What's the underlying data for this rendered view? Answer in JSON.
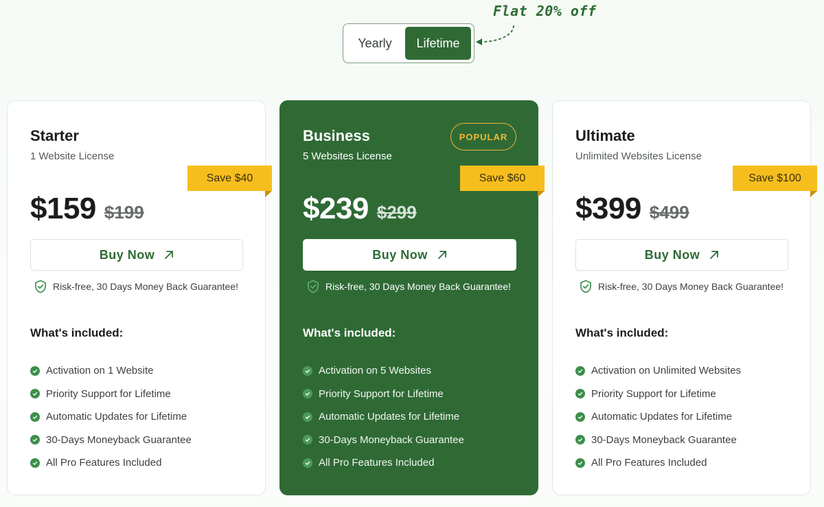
{
  "billing_toggle": {
    "options": [
      {
        "label": "Yearly",
        "active": false
      },
      {
        "label": "Lifetime",
        "active": true
      }
    ],
    "promo_note": "Flat 20% off"
  },
  "colors": {
    "brand_green": "#2f6a35",
    "badge_yellow": "#f6be1d",
    "popular_outline": "#f0b43b",
    "check_green": "#3d8f4b"
  },
  "plans": [
    {
      "name": "Starter",
      "license": "1 Website License",
      "save": "Save $40",
      "price": "$159",
      "old_price": "$199",
      "buy_label": "Buy Now",
      "guarantee": "Risk-free, 30 Days Money Back Guarantee!",
      "included_title": "What's included:",
      "features": [
        "Activation on 1 Website",
        "Priority Support for Lifetime",
        "Automatic Updates for Lifetime",
        "30-Days Moneyback Guarantee",
        "All Pro Features Included"
      ]
    },
    {
      "name": "Business",
      "license": "5 Websites License",
      "badge": "POPULAR",
      "save": "Save $60",
      "price": "$239",
      "old_price": "$299",
      "buy_label": "Buy Now",
      "guarantee": "Risk-free, 30 Days Money Back Guarantee!",
      "included_title": "What's included:",
      "features": [
        "Activation on 5 Websites",
        "Priority Support for Lifetime",
        "Automatic Updates for Lifetime",
        "30-Days Moneyback Guarantee",
        "All Pro Features Included"
      ]
    },
    {
      "name": "Ultimate",
      "license": "Unlimited Websites License",
      "save": "Save $100",
      "price": "$399",
      "old_price": "$499",
      "buy_label": "Buy Now",
      "guarantee": "Risk-free, 30 Days Money Back Guarantee!",
      "included_title": "What's included:",
      "features": [
        "Activation on Unlimited Websites",
        "Priority Support for Lifetime",
        "Automatic Updates for Lifetime",
        "30-Days Moneyback Guarantee",
        "All Pro Features Included"
      ]
    }
  ],
  "icons": {
    "buy": "arrow-up-right-icon",
    "guarantee": "shield-check-icon",
    "feature": "check-circle-icon",
    "promo": "dashed-arrow-icon"
  }
}
